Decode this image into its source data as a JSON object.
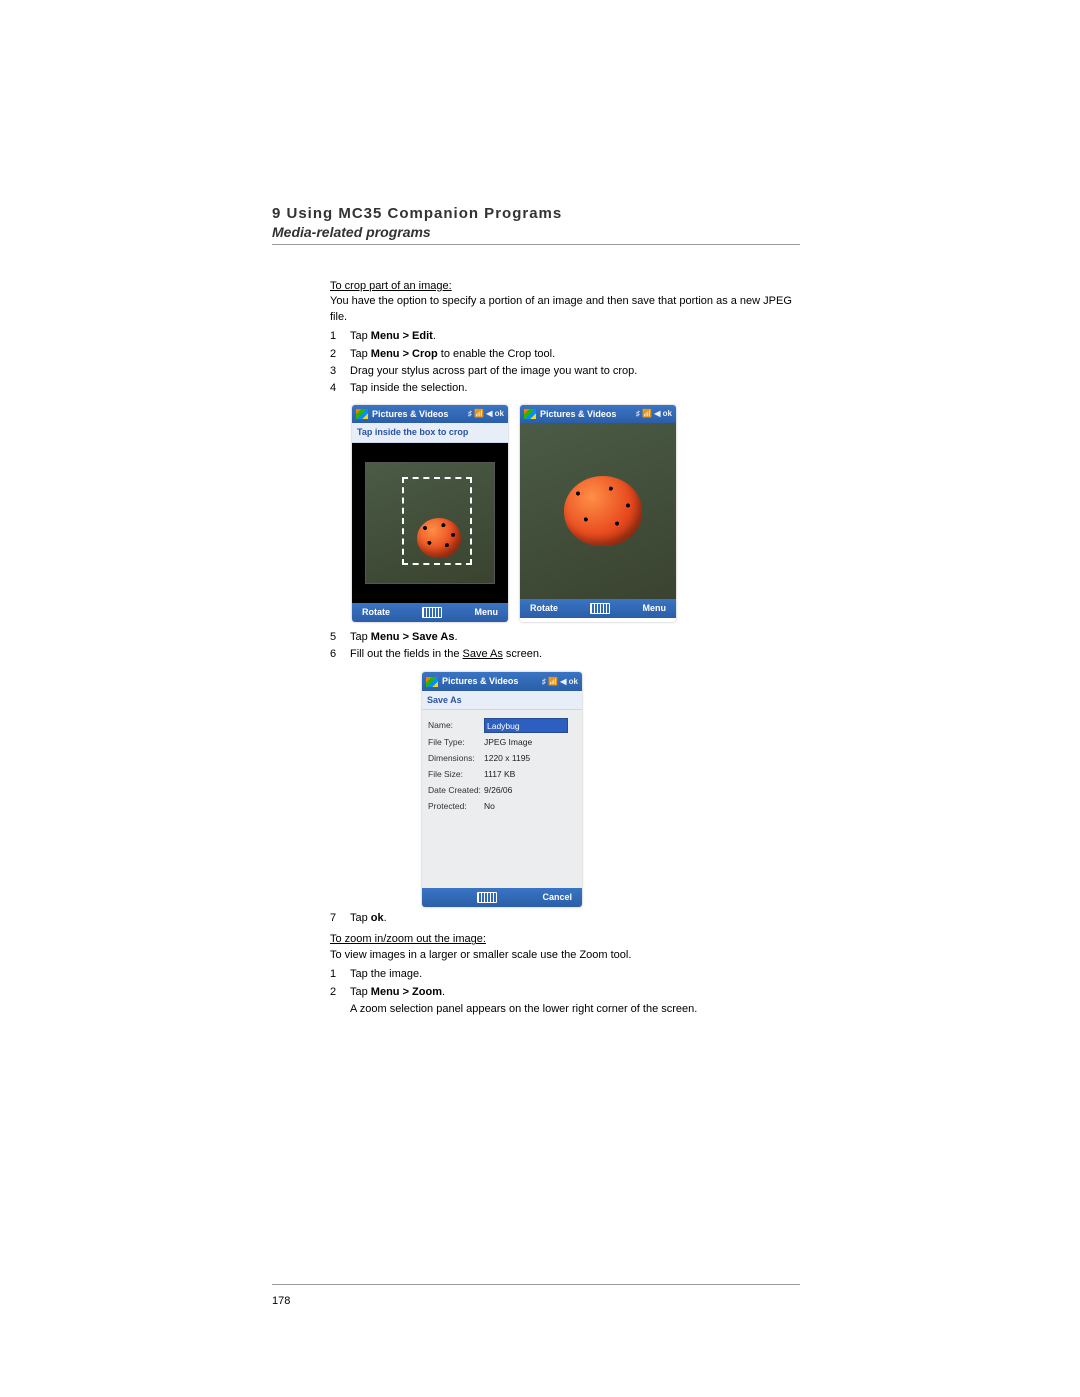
{
  "header": {
    "chapter": "9 Using MC35 Companion Programs",
    "section": "Media-related programs"
  },
  "crop": {
    "heading": "To crop part of an image:",
    "intro": "You have the option to specify a portion of an image and then save that portion as a new JPEG file.",
    "steps": [
      {
        "n": "1",
        "pre": "Tap ",
        "bold": "Menu > Edit",
        "post": "."
      },
      {
        "n": "2",
        "pre": "Tap ",
        "bold": "Menu > Crop",
        "post": " to enable the Crop tool."
      },
      {
        "n": "3",
        "pre": "Drag your stylus across part of the image you want to crop.",
        "bold": "",
        "post": ""
      },
      {
        "n": "4",
        "pre": "Tap inside the selection.",
        "bold": "",
        "post": ""
      }
    ],
    "device_title": "Pictures & Videos",
    "statusbar": "♯ 📶 ◀ ok",
    "msgbar": "Tap inside the box to crop",
    "footer_left": "Rotate",
    "footer_right": "Menu",
    "steps2": [
      {
        "n": "5",
        "pre": "Tap ",
        "bold": "Menu > Save As",
        "post": "."
      },
      {
        "n": "6",
        "pre": "Fill out the fields in the ",
        "under": "Save As",
        "post": " screen."
      }
    ],
    "saveas": {
      "title": "Pictures & Videos",
      "subtitle": "Save As",
      "fields": {
        "name_label": "Name:",
        "name_value": "Ladybug",
        "type_label": "File Type:",
        "type_value": "JPEG Image",
        "dim_label": "Dimensions:",
        "dim_value": "1220 x 1195",
        "size_label": "File Size:",
        "size_value": "1117 KB",
        "date_label": "Date Created:",
        "date_value": "9/26/06",
        "prot_label": "Protected:",
        "prot_value": "No"
      },
      "footer_right": "Cancel"
    },
    "step7": {
      "n": "7",
      "pre": "Tap ",
      "bold": "ok",
      "post": "."
    }
  },
  "zoom": {
    "heading": "To zoom in/zoom out the image:",
    "intro": "To view images in a larger or smaller scale use the Zoom tool.",
    "steps": [
      {
        "n": "1",
        "pre": "Tap the image.",
        "bold": "",
        "post": ""
      },
      {
        "n": "2",
        "pre": "Tap ",
        "bold": "Menu > Zoom",
        "post": "."
      }
    ],
    "note": "A zoom selection panel appears on the lower right corner of the screen."
  },
  "page_number": "178"
}
